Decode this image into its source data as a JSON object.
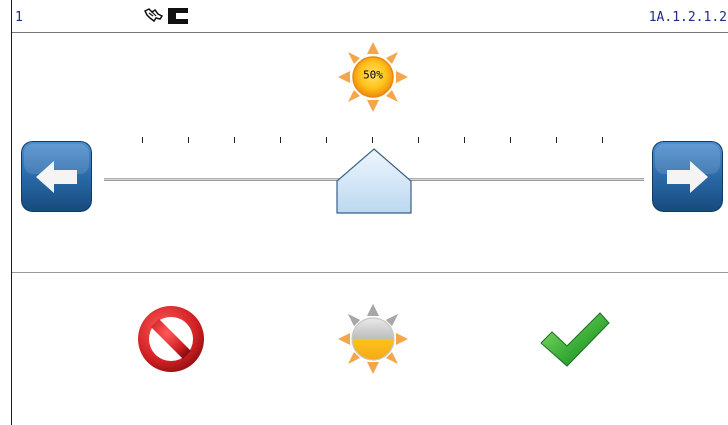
{
  "status": {
    "left_text": "1",
    "right_text": "1A.1.2.1.2"
  },
  "brightness": {
    "value_label": "50%",
    "level_percent": 50
  },
  "slider": {
    "min": 0,
    "max": 100,
    "value": 50,
    "ticks": [
      0,
      10,
      20,
      30,
      40,
      50,
      60,
      70,
      80,
      90,
      100
    ]
  },
  "icons": {
    "hand": "hand-icon",
    "block": "block-icon",
    "sun": "sun-icon",
    "left": "arrow-left-icon",
    "right": "arrow-right-icon",
    "cancel": "prohibited-icon",
    "auto": "sun-half-icon",
    "ok": "checkmark-icon"
  },
  "colors": {
    "status_text": "#1e2b8a",
    "button_blue": "#1f5a93",
    "sun_orange": "#f39a1e",
    "cancel_red": "#d01f22",
    "ok_green": "#35a934",
    "thumb_fill": "#cfe4f6"
  }
}
